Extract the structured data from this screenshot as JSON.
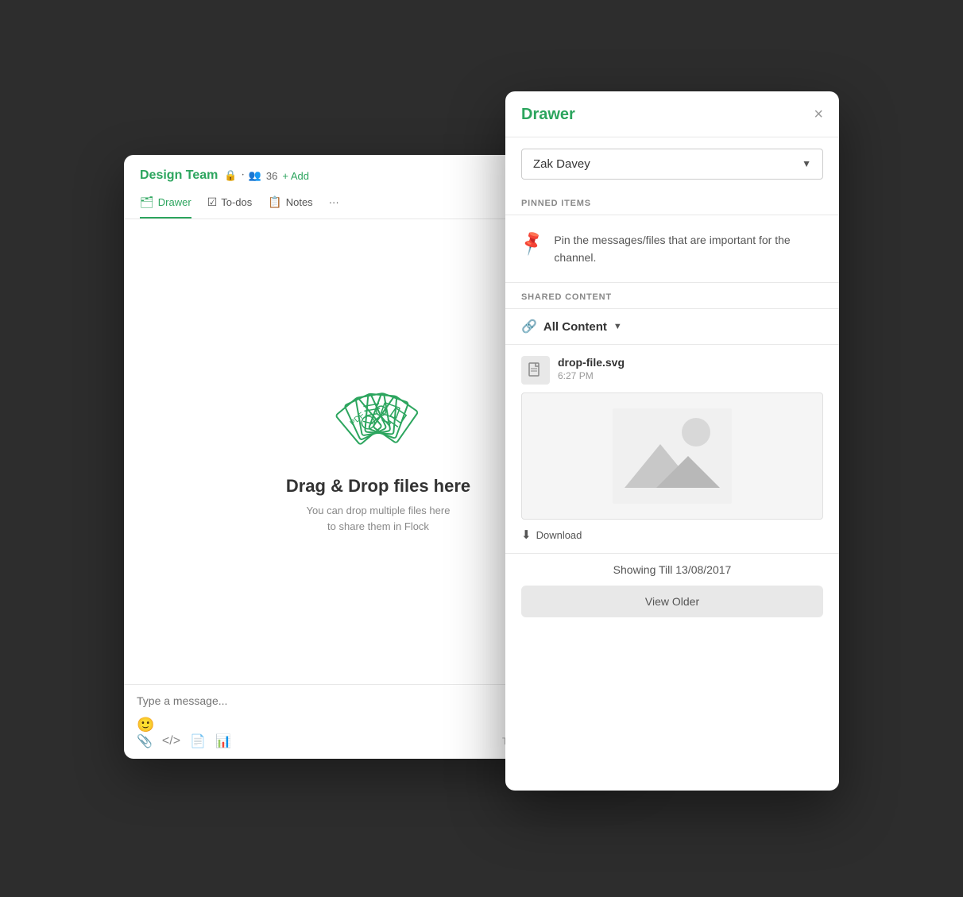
{
  "chat": {
    "title": "Design Team",
    "member_count": "36",
    "add_label": "+ Add",
    "tabs": [
      {
        "id": "drawer",
        "label": "Drawer",
        "icon": "🗂"
      },
      {
        "id": "todos",
        "label": "To-dos",
        "icon": "✅"
      },
      {
        "id": "notes",
        "label": "Notes",
        "icon": "📋"
      },
      {
        "id": "more",
        "label": "···",
        "icon": ""
      }
    ],
    "active_tab": "drawer",
    "drop_title": "Drag & Drop files here",
    "drop_subtitle": "You can drop multiple files here\nto share them in Flock",
    "input_placeholder": "Type a message...",
    "toolbar_hint": "Type '/' for quick commands"
  },
  "drawer": {
    "title": "Drawer",
    "close_label": "×",
    "user": "Zak Davey",
    "pinned_label": "PINNED ITEMS",
    "pin_message": "Pin the messages/files that are important for the channel.",
    "shared_label": "SHARED CONTENT",
    "all_content_label": "All Content",
    "file": {
      "name": "drop-file.svg",
      "time": "6:27 PM",
      "download_label": "Download"
    },
    "showing_till": "Showing Till 13/08/2017",
    "view_older_label": "View Older"
  }
}
